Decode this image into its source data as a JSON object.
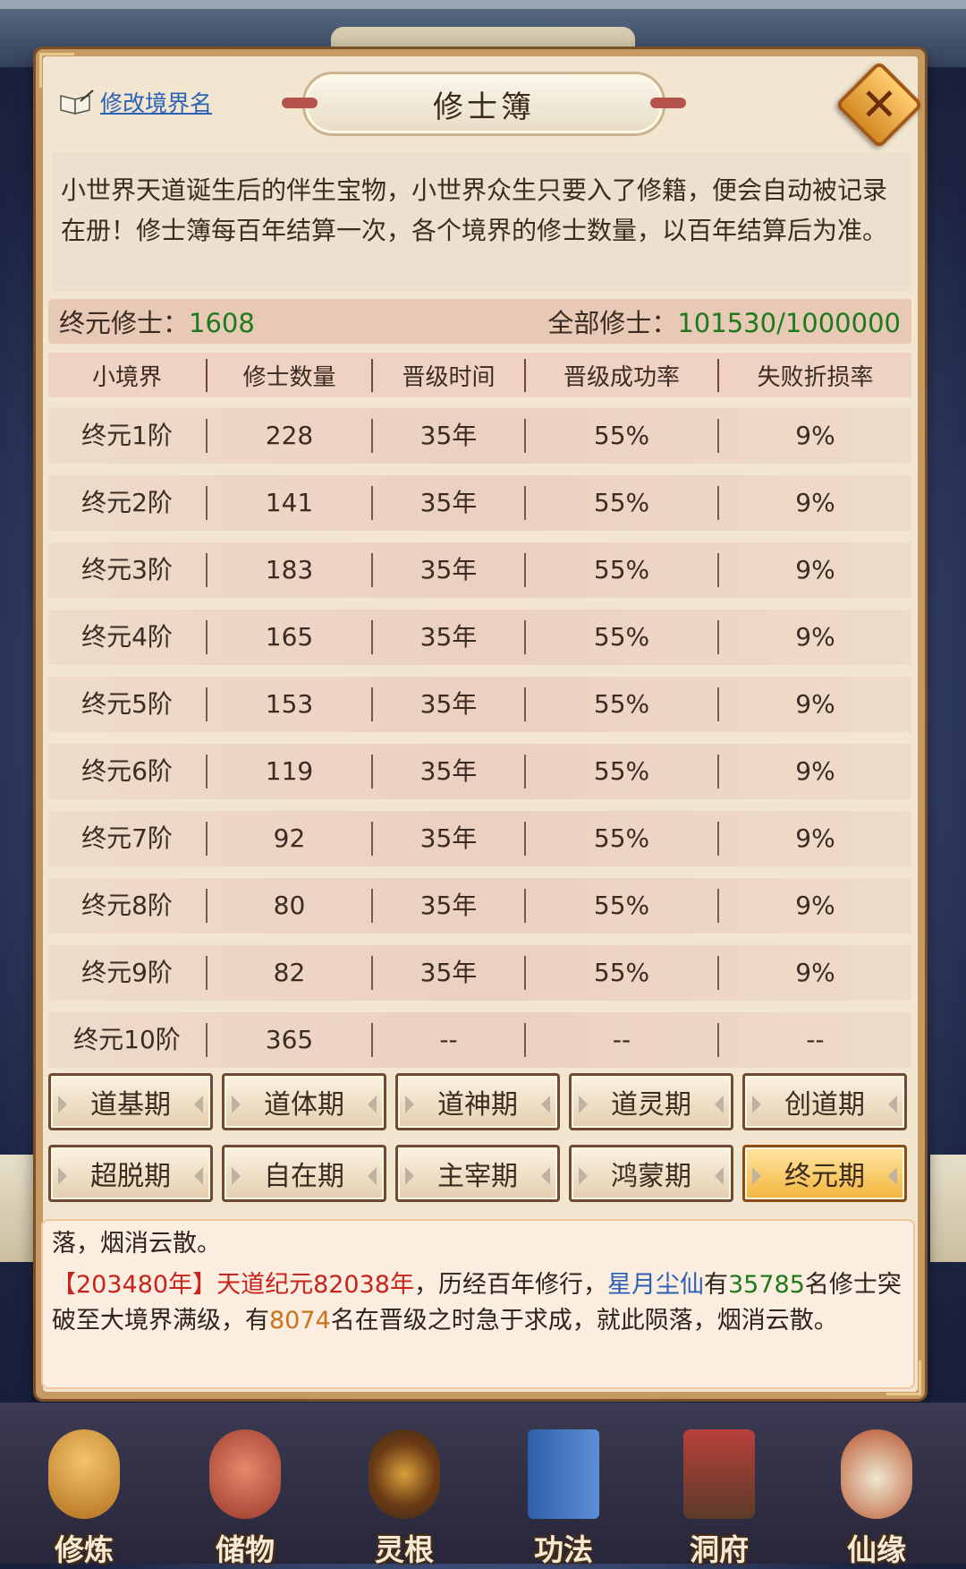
{
  "header": {
    "rename_link": "修改境界名",
    "title": "修士簿",
    "close_symbol": "✕"
  },
  "description": "小世界天道诞生后的伴生宝物，小世界众生只要入了修籍，便会自动被记录在册！修士簿每百年结算一次，各个境界的修士数量，以百年结算后为准。",
  "summary": {
    "realm_label": "终元修士：",
    "realm_count": "1608",
    "total_label": "全部修士：",
    "total_count": "101530/1000000"
  },
  "table": {
    "headers": [
      "小境界",
      "修士数量",
      "晋级时间",
      "晋级成功率",
      "失败折损率"
    ],
    "rows": [
      [
        "终元1阶",
        "228",
        "35年",
        "55%",
        "9%"
      ],
      [
        "终元2阶",
        "141",
        "35年",
        "55%",
        "9%"
      ],
      [
        "终元3阶",
        "183",
        "35年",
        "55%",
        "9%"
      ],
      [
        "终元4阶",
        "165",
        "35年",
        "55%",
        "9%"
      ],
      [
        "终元5阶",
        "153",
        "35年",
        "55%",
        "9%"
      ],
      [
        "终元6阶",
        "119",
        "35年",
        "55%",
        "9%"
      ],
      [
        "终元7阶",
        "92",
        "35年",
        "55%",
        "9%"
      ],
      [
        "终元8阶",
        "80",
        "35年",
        "55%",
        "9%"
      ],
      [
        "终元9阶",
        "82",
        "35年",
        "55%",
        "9%"
      ],
      [
        "终元10阶",
        "365",
        "--",
        "--",
        "--"
      ]
    ]
  },
  "realm_buttons": {
    "row1": [
      "道基期",
      "道体期",
      "道神期",
      "道灵期",
      "创道期"
    ],
    "row2": [
      "超脱期",
      "自在期",
      "主宰期",
      "鸿蒙期",
      "终元期"
    ],
    "selected": "终元期"
  },
  "log": {
    "line1": "落，烟消云散。",
    "entry_bracket": "【203480年】",
    "entry_era": "天道纪元82038年",
    "entry_text1": "，历经百年修行，",
    "entry_world": "星月尘仙",
    "entry_text2": "有",
    "entry_count1": "35785",
    "entry_text3": "名修士突破至大境界满级，有",
    "entry_count2": "8074",
    "entry_text4": "名在晋级之时急于求成，就此陨落，烟消云散。"
  },
  "bottom_nav": [
    {
      "label": "修炼",
      "icon": "cultivate-icon"
    },
    {
      "label": "储物",
      "icon": "storage-bag-icon"
    },
    {
      "label": "灵根",
      "icon": "spirit-root-icon"
    },
    {
      "label": "功法",
      "icon": "technique-book-icon"
    },
    {
      "label": "洞府",
      "icon": "cave-mansion-icon"
    },
    {
      "label": "仙缘",
      "icon": "immortal-fate-icon"
    }
  ],
  "colors": {
    "accent_green": "#1c7a1c",
    "log_red": "#c8231c",
    "log_blue": "#2a5fb3",
    "log_orange": "#c9731b",
    "link_blue": "#2b62b6",
    "selected_button": "#f2b53c"
  }
}
